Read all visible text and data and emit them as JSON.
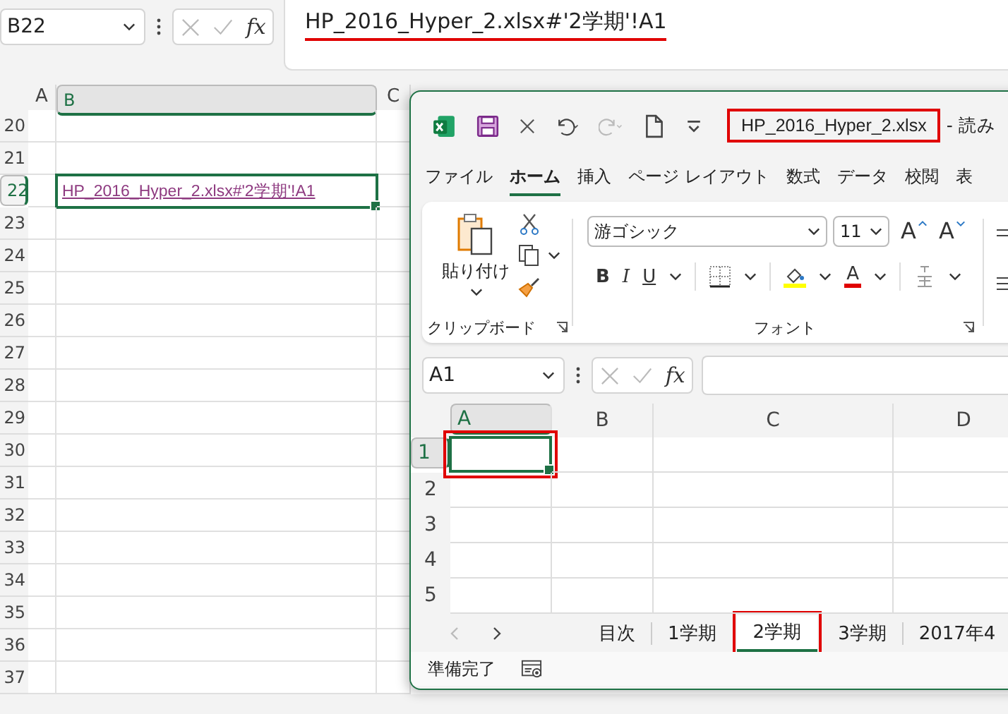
{
  "formula_bar": {
    "name_box": "B22",
    "fx": "fx",
    "formula": "HP_2016_Hyper_2.xlsx#'2学期'!A1",
    "highlighted": true
  },
  "sheet": {
    "columns": [
      {
        "label": "A",
        "selected": false
      },
      {
        "label": "B",
        "selected": true
      },
      {
        "label": "C",
        "selected": false
      }
    ],
    "rows": [
      {
        "number": "20",
        "selected": false
      },
      {
        "number": "21",
        "selected": false
      },
      {
        "number": "22",
        "selected": true,
        "link": "HP_2016_Hyper_2.xlsx#'2学期'!A1"
      },
      {
        "number": "23",
        "selected": false
      },
      {
        "number": "24",
        "selected": false
      },
      {
        "number": "25",
        "selected": false
      },
      {
        "number": "26",
        "selected": false
      },
      {
        "number": "27",
        "selected": false
      },
      {
        "number": "28",
        "selected": false
      },
      {
        "number": "29",
        "selected": false
      },
      {
        "number": "30",
        "selected": false
      },
      {
        "number": "31",
        "selected": false
      },
      {
        "number": "32",
        "selected": false
      },
      {
        "number": "33",
        "selected": false
      },
      {
        "number": "34",
        "selected": false
      },
      {
        "number": "35",
        "selected": false
      },
      {
        "number": "36",
        "selected": false
      },
      {
        "number": "37",
        "selected": false
      }
    ]
  },
  "window": {
    "title": "HP_2016_Hyper_2.xlsx",
    "title_highlighted": true,
    "title_suffix": "- 読み",
    "ribbon_tabs": [
      {
        "label": "ファイル",
        "selected": false
      },
      {
        "label": "ホーム",
        "selected": true
      },
      {
        "label": "挿入",
        "selected": false
      },
      {
        "label": "ページ レイアウト",
        "selected": false
      },
      {
        "label": "数式",
        "selected": false
      },
      {
        "label": "データ",
        "selected": false
      },
      {
        "label": "校閲",
        "selected": false
      },
      {
        "label": "表",
        "selected": false
      }
    ],
    "clipboard": {
      "paste": "貼り付け",
      "label": "クリップボード"
    },
    "font": {
      "name": "游ゴシック",
      "size": "11",
      "grow": "A",
      "shrink": "A",
      "bold": "B",
      "italic": "I",
      "underline": "U",
      "color_letter": "A",
      "label": "フォント"
    },
    "formula_bar": {
      "name_box": "A1",
      "fx": "fx"
    },
    "grid": {
      "columns": [
        {
          "label": "A",
          "selected": true
        },
        {
          "label": "B",
          "selected": false
        },
        {
          "label": "C",
          "selected": false
        },
        {
          "label": "D",
          "selected": false
        }
      ],
      "rows": [
        {
          "number": "1",
          "selected": true
        },
        {
          "number": "2",
          "selected": false
        },
        {
          "number": "3",
          "selected": false
        },
        {
          "number": "4",
          "selected": false
        },
        {
          "number": "5",
          "selected": false
        }
      ],
      "active_cell_highlighted": true
    },
    "sheet_tabs": [
      {
        "label": "目次",
        "selected": false,
        "highlighted": false
      },
      {
        "label": "1学期",
        "selected": false,
        "highlighted": false
      },
      {
        "label": "2学期",
        "selected": true,
        "highlighted": true
      },
      {
        "label": "3学期",
        "selected": false,
        "highlighted": false
      },
      {
        "label": "2017年4",
        "selected": false,
        "highlighted": false
      }
    ],
    "status": "準備完了"
  }
}
